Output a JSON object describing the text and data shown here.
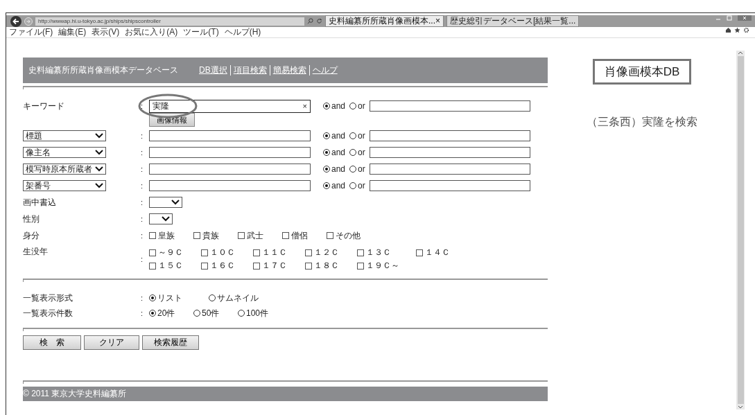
{
  "browser": {
    "url": "http://wwwap.hi.u-tokyo.ac.jp/ships/shipscontroller",
    "tabs": [
      {
        "title": "史料編纂所所蔵肖像画模本...",
        "close": "×",
        "selected": true
      },
      {
        "title": "歴史総引データベース[結果一覧...",
        "selected": false
      }
    ],
    "menu": [
      "ファイル(F)",
      "編集(E)",
      "表示(V)",
      "お気に入り(A)",
      "ツール(T)",
      "ヘルプ(H)"
    ]
  },
  "header": {
    "title": "史料編纂所所蔵肖像画模本データベース",
    "links": [
      "DB選択",
      "項目検索",
      "簡易検索",
      "ヘルプ"
    ]
  },
  "keyword": {
    "label": "キーワード",
    "colon": ":",
    "value": "実隆",
    "clear": "×",
    "button": "画像情報",
    "ops": [
      {
        "label": "and",
        "selected": true
      },
      {
        "label": "or",
        "selected": false
      }
    ],
    "highlighted": true
  },
  "field_rows": [
    {
      "field": "標題",
      "colon": ":",
      "ops": [
        {
          "label": "and",
          "selected": true
        },
        {
          "label": "or",
          "selected": false
        }
      ]
    },
    {
      "field": "像主名",
      "colon": ":",
      "ops": [
        {
          "label": "and",
          "selected": true
        },
        {
          "label": "or",
          "selected": false
        }
      ]
    },
    {
      "field": "模写時原本所蔵者",
      "colon": ":",
      "ops": [
        {
          "label": "and",
          "selected": true
        },
        {
          "label": "or",
          "selected": false
        }
      ]
    },
    {
      "field": "架番号",
      "colon": ":",
      "ops": [
        {
          "label": "and",
          "selected": true
        },
        {
          "label": "or",
          "selected": false
        }
      ]
    }
  ],
  "select_rows": [
    {
      "label": "画中書込",
      "colon": ":"
    },
    {
      "label": "性別",
      "colon": ":"
    }
  ],
  "status": {
    "label": "身分",
    "colon": ":",
    "options": [
      {
        "label": "皇族",
        "checked": false
      },
      {
        "label": "貴族",
        "checked": false
      },
      {
        "label": "武士",
        "checked": false
      },
      {
        "label": "僧侶",
        "checked": false
      },
      {
        "label": "その他",
        "checked": false
      }
    ]
  },
  "era": {
    "label": "生没年",
    "colon": ":",
    "lines": [
      [
        {
          "label": "～９Ｃ",
          "checked": false
        },
        {
          "label": "１０Ｃ",
          "checked": false
        },
        {
          "label": "１１Ｃ",
          "checked": false
        },
        {
          "label": "１２Ｃ",
          "checked": false
        },
        {
          "label": "１３Ｃ",
          "checked": false
        },
        {
          "label": "１４Ｃ",
          "checked": false
        }
      ],
      [
        {
          "label": "１５Ｃ",
          "checked": false
        },
        {
          "label": "１６Ｃ",
          "checked": false
        },
        {
          "label": "１７Ｃ",
          "checked": false
        },
        {
          "label": "１８Ｃ",
          "checked": false
        },
        {
          "label": "１９Ｃ～",
          "checked": false
        }
      ]
    ]
  },
  "display": [
    {
      "label": "一覧表示形式",
      "colon": ":",
      "options": [
        {
          "label": "リスト",
          "selected": true
        },
        {
          "label": "サムネイル",
          "selected": false
        }
      ]
    },
    {
      "label": "一覧表示件数",
      "colon": ":",
      "options": [
        {
          "label": "20件",
          "selected": true
        },
        {
          "label": "50件",
          "selected": false
        },
        {
          "label": "100件",
          "selected": false
        }
      ]
    }
  ],
  "buttons": [
    "検　索",
    "クリア",
    "検索履歴"
  ],
  "footer": "© 2011 東京大学史料編纂所",
  "annotation": {
    "label": "肖像画模本DB",
    "note": "（三条西）実隆を検索"
  }
}
